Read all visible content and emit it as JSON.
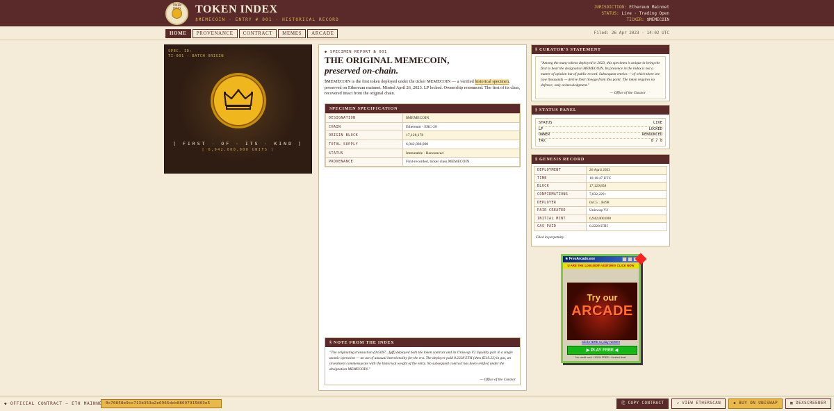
{
  "header": {
    "logo_text": "TOKEN INDEX",
    "title": "TOKEN INDEX",
    "subtitle": "$MEMECOIN · ENTRY # 001 · HISTORICAL RECORD",
    "jurisdiction_label": "JURISDICTION:",
    "jurisdiction": "Ethereum Mainnet",
    "status_label": "STATUS:",
    "status": "Live · Trading Open",
    "ticker_label": "TICKER:",
    "ticker": "$MEMECOIN"
  },
  "nav": {
    "items": [
      "HOME",
      "PROVENANCE",
      "CONTRACT",
      "MEMES",
      "ARCADE"
    ],
    "filed": "Filed: 26 Apr 2023 · 14:02 UTC"
  },
  "token_image": {
    "spec_id": "SPEC. ID:",
    "spec_code": "TI-001 · BATCH ORIGIN",
    "first_of_kind": "[ FIRST · OF · ITS · KIND ]",
    "units": "[ 6,942,000,000 UNITS ]"
  },
  "report": {
    "tag": "◆ SPECIMEN REPORT № 001",
    "title": "THE ORIGINAL MEMECOIN,",
    "title_italic": "preserved on-chain.",
    "desc_a": "$MEMECOIN is the first token deployed under the ticker MEMECOIN — a verified",
    "desc_hl": "historical specimen",
    "desc_b": ", preserved on Ethereum mainnet. Minted April 26, 2023. LP locked. Ownership renounced. The first of its class, recovered intact from the original chain.",
    "spec_title": "SPECIMEN SPECIFICATION",
    "specs": [
      {
        "k": "DESIGNATION",
        "v": "$MEMECOIN"
      },
      {
        "k": "CHAIN",
        "v": "Ethereum · ERC-20"
      },
      {
        "k": "ORIGIN BLOCK",
        "v": "17,128,178"
      },
      {
        "k": "TOTAL SUPPLY",
        "v": "6,942,000,000"
      },
      {
        "k": "STATUS",
        "v": "Immutable · Renounced"
      },
      {
        "k": "PROVENANCE",
        "v": "First-recorded, ticker class MEMECOIN"
      }
    ],
    "note_title": "§ NOTE FROM THE INDEX",
    "note_body": "\"The originating transaction (0x5697…fgff) deployed both the token contract and its Uniswap V2 liquidity pair in a single atomic operation — an act of unusual intentionality for the era. The deployer paid 0.2228 ETH (then $519.23) in gas, an investment commensurate with the historical weight of the entry. No subsequent contract has been verified under the designation MEMECOIN.\"",
    "note_sign": "— Office of the Curator"
  },
  "curator": {
    "title": "§ CURATOR'S STATEMENT",
    "body": "\"Among the many tokens deployed in 2023, this specimen is unique in being the first to bear the designation MEMECOIN. Its presence in the index is not a matter of opinion but of public record. Subsequent entries — of which there are now thousands — derive their lineage from this point. The token requires no defence; only acknowledgment.\"",
    "sign": "— Office of the Curator"
  },
  "status_panel": {
    "title": "§ STATUS PANEL",
    "rows": [
      {
        "k": "STATUS",
        "v": "LIVE"
      },
      {
        "k": "LP",
        "v": "LOCKED"
      },
      {
        "k": "OWNER",
        "v": "RENOUNCED"
      },
      {
        "k": "TAX",
        "v": "0 / 0"
      }
    ]
  },
  "genesis": {
    "title": "§ GENESIS RECORD",
    "rows": [
      {
        "k": "DEPLOYMENT",
        "v": "26 April 2023"
      },
      {
        "k": "TIME",
        "v": "10:16:47 UTC"
      },
      {
        "k": "BLOCK",
        "v": "17,129,858"
      },
      {
        "k": "CONFIRMATIONS",
        "v": "7,832,229+"
      },
      {
        "k": "DEPLOYER",
        "v": "0xC5…Bc98"
      },
      {
        "k": "PAIR CREATED",
        "v": "Uniswap V2"
      },
      {
        "k": "INITIAL MINT",
        "v": "6,942,000,000"
      },
      {
        "k": "GAS PAID",
        "v": "0.2228 ETH"
      }
    ],
    "footer": "Filed in perpetuity."
  },
  "ad": {
    "window_title": "★ FreeArcade.exe",
    "strip": "U ARE THE 1,000,000th VISITOR!!! CLICK NOW",
    "line1": "Try our",
    "line2": "ARCADE",
    "link": "Click HERE to play NOW!!!",
    "play": "▶ PLAY FREE ◀",
    "foot": "No credit card • 100% FREE • Limited time!"
  },
  "bottom": {
    "contract_label": "◆ OFFICIAL CONTRACT — ETH MAINNET",
    "contract_address": "0x70858e9cc713b353a2e6965dcb88697915803e5",
    "copy": "⎘ COPY CONTRACT",
    "etherscan": "↗ VIEW ETHERSCAN",
    "uniswap": "◆ BUY ON UNISWAP",
    "dexscreener": "▦ DEXSCREENER"
  }
}
